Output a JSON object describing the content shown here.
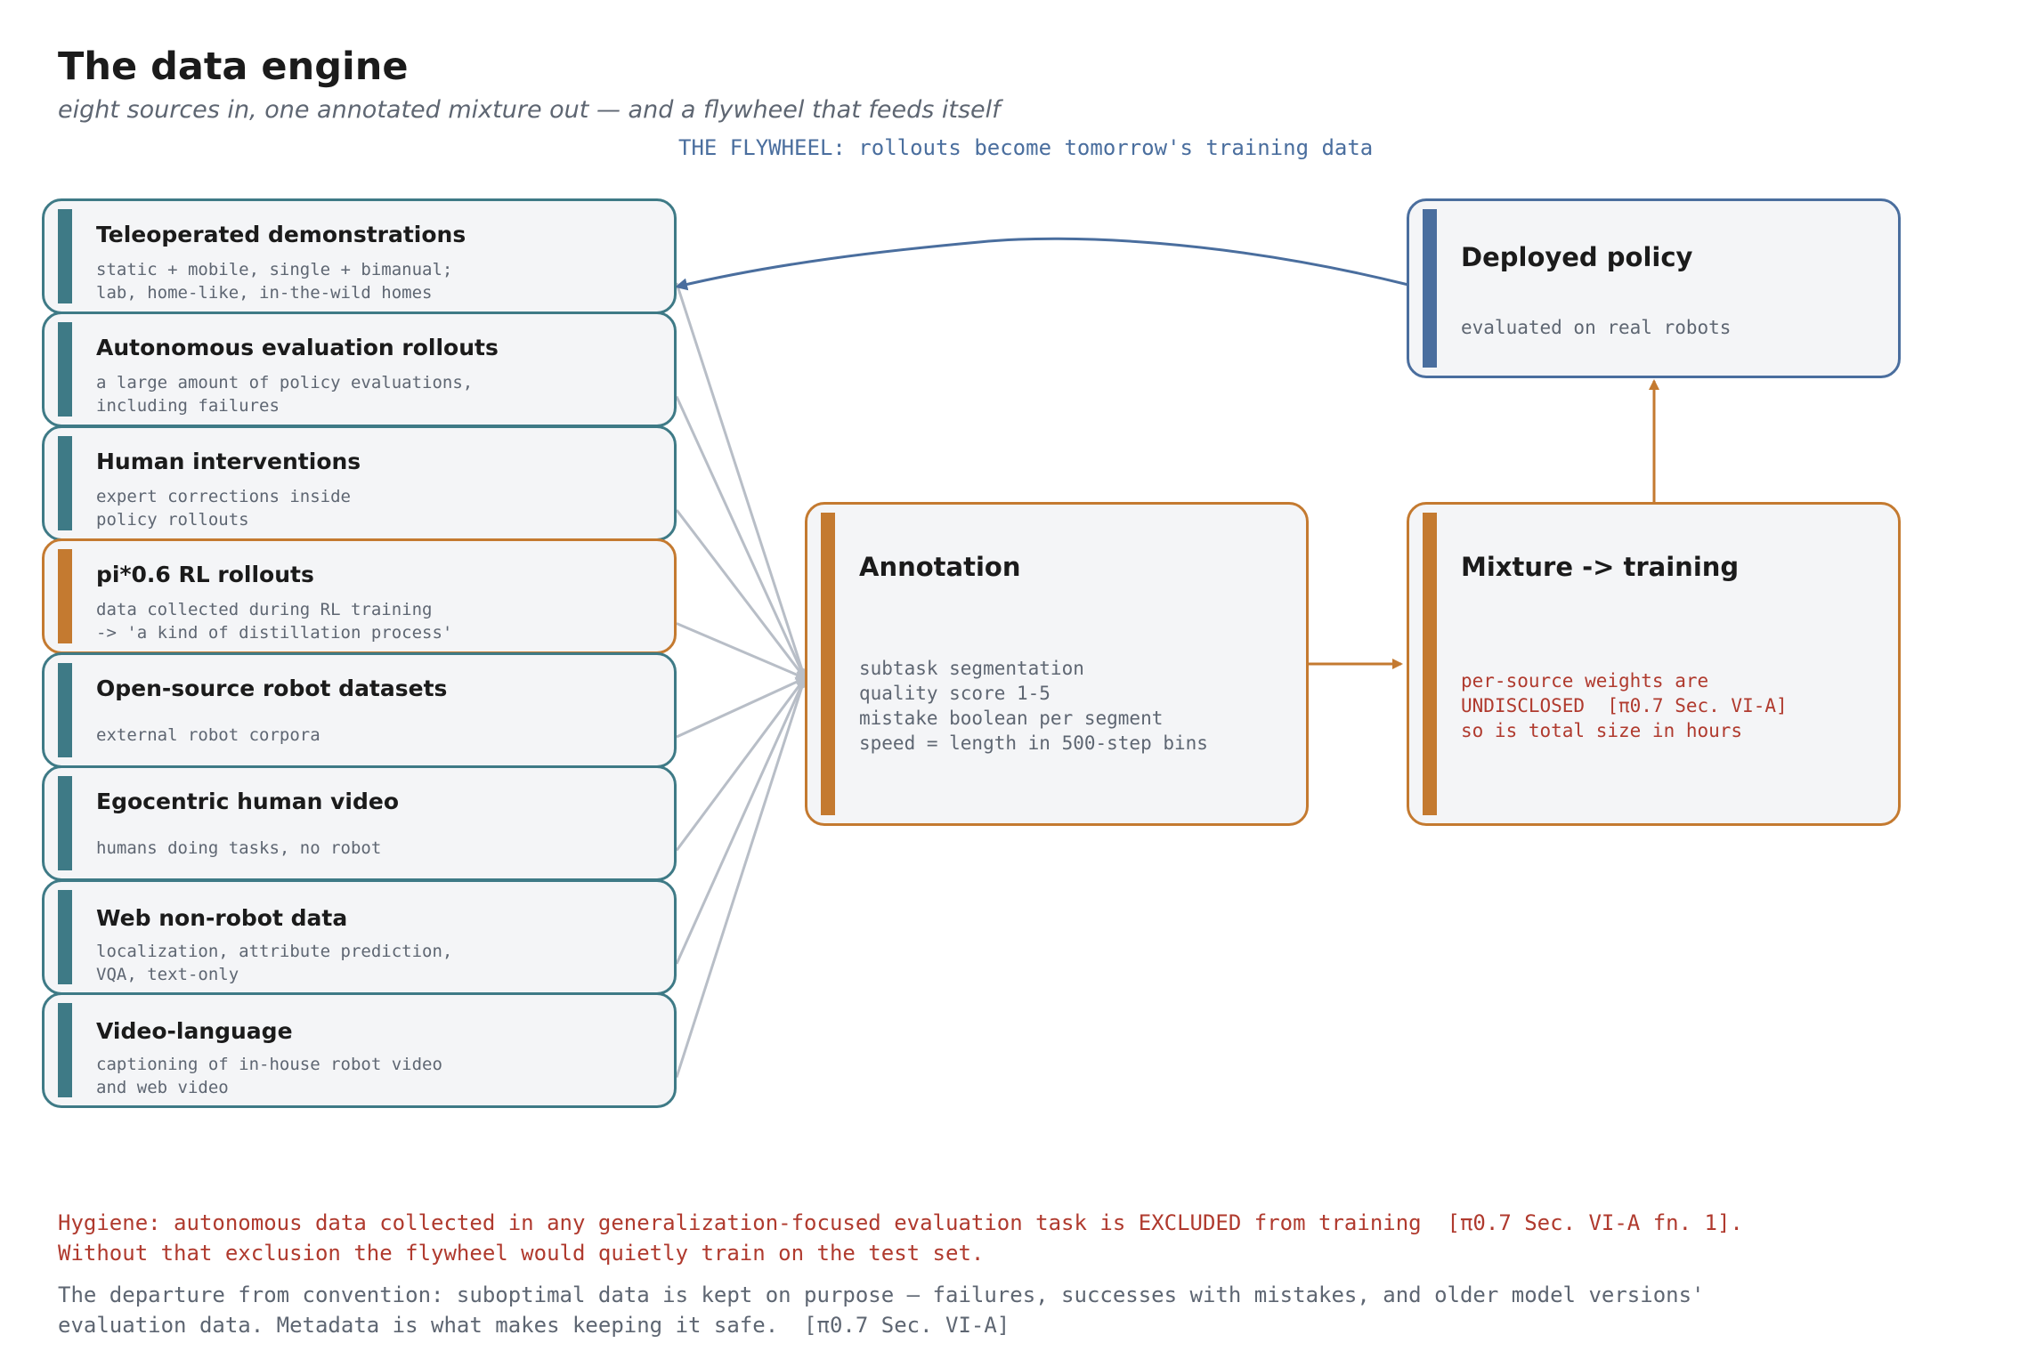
{
  "header": {
    "title": "The data engine",
    "subtitle": "eight sources in, one annotated mixture out — and a flywheel that feeds itself",
    "flywheel_caption": "THE FLYWHEEL: rollouts become tomorrow's training data"
  },
  "sources": [
    {
      "title": "Teleoperated demonstrations",
      "desc": "static + mobile, single + bimanual;\nlab, home-like, in-the-wild homes"
    },
    {
      "title": "Autonomous evaluation rollouts",
      "desc": "a large amount of policy evaluations,\nincluding failures"
    },
    {
      "title": "Human interventions",
      "desc": "expert corrections inside\npolicy rollouts"
    },
    {
      "title": "pi*0.6 RL rollouts",
      "desc": "data collected during RL training\n-> 'a kind of distillation process'"
    },
    {
      "title": "Open-source robot datasets",
      "desc": "external robot corpora"
    },
    {
      "title": "Egocentric human video",
      "desc": "humans doing tasks, no robot"
    },
    {
      "title": "Web non-robot data",
      "desc": "localization, attribute prediction,\nVQA, text-only"
    },
    {
      "title": "Video-language",
      "desc": "captioning of in-house robot video\nand web video"
    }
  ],
  "annotation": {
    "title": "Annotation",
    "desc": "subtask segmentation\nquality score 1-5\nmistake boolean per segment\nspeed = length in 500-step bins"
  },
  "mixture": {
    "title": "Mixture -> training",
    "desc": "per-source weights are\nUNDISCLOSED  [π0.7 Sec. VI-A]\nso is total size in hours"
  },
  "deployed": {
    "title": "Deployed policy",
    "desc": "evaluated on real robots"
  },
  "footer": {
    "hygiene": "Hygiene: autonomous data collected in any generalization-focused evaluation task is EXCLUDED from training  [π0.7 Sec. VI-A fn. 1].\nWithout that exclusion the flywheel would quietly train on the test set.",
    "departure": "The departure from convention: suboptimal data is kept on purpose — failures, successes with mistakes, and older model versions'\nevaluation data. Metadata is what makes keeping it safe.  [π0.7 Sec. VI-A]"
  },
  "colors": {
    "teal": "#3e7a86",
    "orange": "#c47a30",
    "blue": "#4a6e9e",
    "red": "#b03a2e",
    "grey_line": "#b8bec7"
  }
}
